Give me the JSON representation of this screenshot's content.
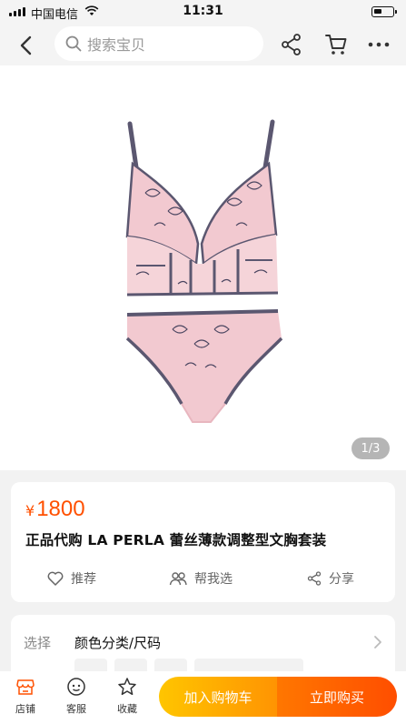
{
  "status_bar": {
    "carrier": "中国电信",
    "time": "11:31"
  },
  "nav": {
    "search_placeholder": "搜索宝贝",
    "icons": [
      "back-icon",
      "search-icon",
      "share-icon",
      "cart-icon",
      "more-icon"
    ]
  },
  "gallery": {
    "counter": "1/3",
    "current_index": 1,
    "total": 3
  },
  "product": {
    "currency": "¥",
    "price": "1800",
    "title": "正品代购 LA PERLA 蕾丝薄款调整型文胸套装"
  },
  "actions": {
    "recommend": "推荐",
    "help_choose": "帮我选",
    "share": "分享"
  },
  "selection": {
    "label": "选择",
    "value": "颜色分类/尺码"
  },
  "bottom_bar": {
    "store": "店铺",
    "service": "客服",
    "favorite": "收藏",
    "add_to_cart": "加入购物车",
    "buy_now": "立即购买"
  },
  "colors": {
    "accent": "#ff5000",
    "cart_gradient": [
      "#ffc500",
      "#ff9402"
    ],
    "buy_gradient": [
      "#ff7700",
      "#ff4e00"
    ],
    "lingerie_pink": "#f2c9d0",
    "lingerie_trim": "#5b5770"
  }
}
